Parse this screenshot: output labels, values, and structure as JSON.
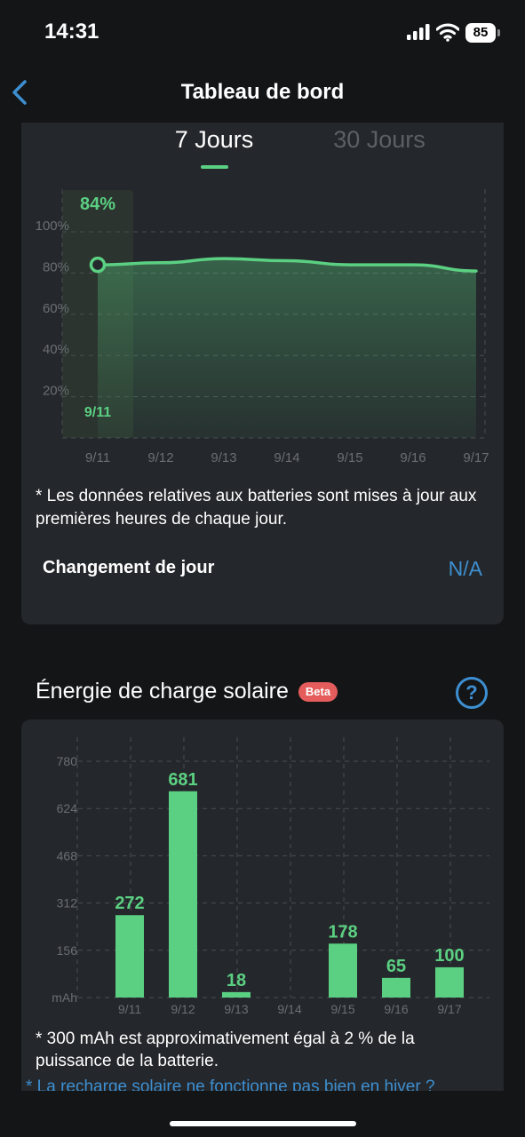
{
  "status_bar": {
    "time": "14:31",
    "battery_level": "85"
  },
  "nav": {
    "title": "Tableau de bord",
    "back_icon": "chevron-left-icon"
  },
  "battery_card": {
    "tabs": [
      {
        "label": "7 Jours",
        "selected": true
      },
      {
        "label": "30 Jours",
        "selected": false
      }
    ],
    "footnote": "* Les données relatives aux batteries sont mises à jour aux premières heures de chaque jour.",
    "change_label": "Changement de jour",
    "change_value": "N/A"
  },
  "solar": {
    "title": "Énergie de charge solaire",
    "beta_label": "Beta",
    "help_icon": "question-circle-icon",
    "footnote": "* 300 mAh est approximativement égal à 2 % de la puissance de la batterie.",
    "winter_link": "* La recharge solaire ne fonctionne pas bien en hiver ?"
  },
  "colors": {
    "accent": "#5bd082",
    "link": "#3d8fd1",
    "card": "#24272b",
    "background": "#141517",
    "beta": "#e45c5c"
  },
  "chart_data": [
    {
      "type": "line",
      "x": [
        "9/11",
        "9/12",
        "9/13",
        "9/14",
        "9/15",
        "9/16",
        "9/17"
      ],
      "series": [
        {
          "values": [
            84,
            85,
            87,
            86,
            84,
            84,
            81
          ]
        }
      ],
      "ytick_labels": [
        "20%",
        "40%",
        "60%",
        "80%",
        "100%"
      ],
      "yticks": [
        20,
        40,
        60,
        80,
        100
      ],
      "ylim": [
        0,
        100
      ],
      "highlight": {
        "x": "9/11",
        "label": "84%",
        "x_label": "9/11"
      },
      "grid": true
    },
    {
      "type": "bar",
      "categories": [
        "9/11",
        "9/12",
        "9/13",
        "9/14",
        "9/15",
        "9/16",
        "9/17"
      ],
      "values": [
        272,
        681,
        18,
        null,
        178,
        65,
        100
      ],
      "data_labels": [
        "272",
        "681",
        "18",
        "",
        "178",
        "65",
        "100"
      ],
      "ytick_labels": [
        "mAh",
        "156",
        "312",
        "468",
        "624",
        "780"
      ],
      "yticks": [
        0,
        156,
        312,
        468,
        624,
        780
      ],
      "ylim": [
        0,
        780
      ],
      "grid": true
    }
  ]
}
